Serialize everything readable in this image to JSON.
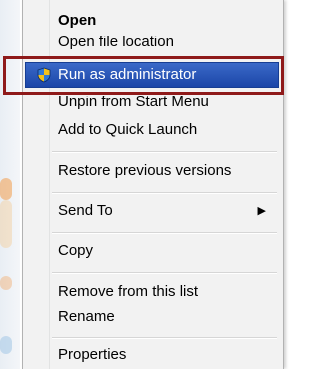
{
  "menu": {
    "open": "Open",
    "open_file_location": "Open file location",
    "run_as_admin": "Run as administrator",
    "unpin": "Unpin from Start Menu",
    "add_quick_launch": "Add to Quick Launch",
    "restore": "Restore previous versions",
    "send_to": "Send To",
    "copy": "Copy",
    "remove": "Remove from this list",
    "rename": "Rename",
    "properties": "Properties"
  },
  "icons": {
    "run_as_admin": "uac-shield-icon",
    "send_to_submenu": "chevron-right-icon"
  },
  "colors": {
    "highlight": "#2854b5",
    "callout_border": "#8f1a1a",
    "menu_bg": "#f2f2f2"
  }
}
